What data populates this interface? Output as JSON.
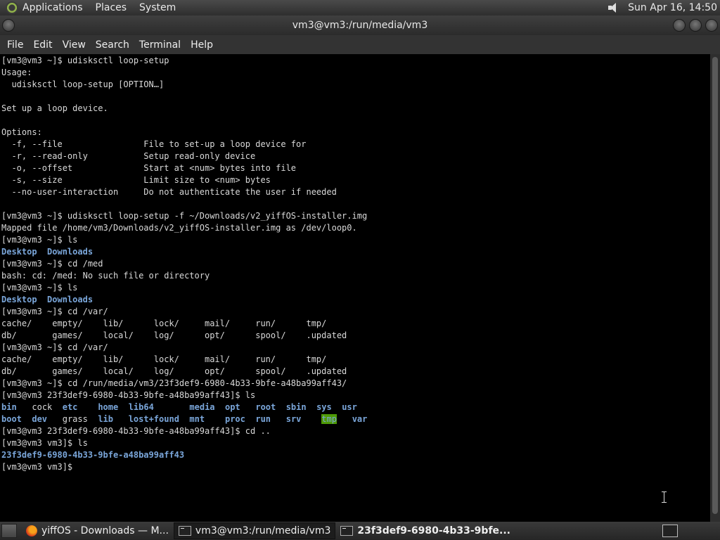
{
  "panel": {
    "menus": [
      "Applications",
      "Places",
      "System"
    ],
    "clock": "Sun Apr 16, 14:50"
  },
  "window": {
    "title": "vm3@vm3:/run/media/vm3"
  },
  "menubar": [
    "File",
    "Edit",
    "View",
    "Search",
    "Terminal",
    "Help"
  ],
  "terminal": {
    "lines": [
      "[vm3@vm3 ~]$ udisksctl loop-setup",
      "Usage:",
      "  udisksctl loop-setup [OPTION…]",
      "",
      "Set up a loop device.",
      "",
      "Options:",
      "  -f, --file                File to set-up a loop device for",
      "  -r, --read-only           Setup read-only device",
      "  -o, --offset              Start at <num> bytes into file",
      "  -s, --size                Limit size to <num> bytes",
      "  --no-user-interaction     Do not authenticate the user if needed",
      "",
      "[vm3@vm3 ~]$ udisksctl loop-setup -f ~/Downloads/v2_yiffOS-installer.img",
      "Mapped file /home/vm3/Downloads/v2_yiffOS-installer.img as /dev/loop0.",
      "[vm3@vm3 ~]$ ls",
      "__LS1__",
      "[vm3@vm3 ~]$ cd /med",
      "bash: cd: /med: No such file or directory",
      "[vm3@vm3 ~]$ ls",
      "__LS2__",
      "[vm3@vm3 ~]$ cd /var/",
      "cache/    empty/    lib/      lock/     mail/     run/      tmp/",
      "db/       games/    local/    log/      opt/      spool/    .updated",
      "[vm3@vm3 ~]$ cd /var/",
      "cache/    empty/    lib/      lock/     mail/     run/      tmp/",
      "db/       games/    local/    log/      opt/      spool/    .updated",
      "[vm3@vm3 ~]$ cd /run/media/vm3/23f3def9-6980-4b33-9bfe-a48ba99aff43/",
      "[vm3@vm3 23f3def9-6980-4b33-9bfe-a48ba99aff43]$ ls",
      "__LS3__",
      "__LS4__",
      "[vm3@vm3 23f3def9-6980-4b33-9bfe-a48ba99aff43]$ cd ..",
      "[vm3@vm3 vm3]$ ls",
      "__LS5__",
      "[vm3@vm3 vm3]$ "
    ],
    "ls_home": [
      [
        "Desktop",
        "dir"
      ],
      [
        "  ",
        ""
      ],
      [
        "Downloads",
        "dir"
      ]
    ],
    "ls_root_1": [
      [
        "bin",
        "dir"
      ],
      [
        "   ",
        ""
      ],
      [
        "cock",
        ""
      ],
      [
        "  ",
        ""
      ],
      [
        "etc",
        "dir"
      ],
      [
        "    ",
        ""
      ],
      [
        "home",
        "dir"
      ],
      [
        "  ",
        ""
      ],
      [
        "lib64",
        "dir"
      ],
      [
        "       ",
        ""
      ],
      [
        "media",
        "dir"
      ],
      [
        "  ",
        ""
      ],
      [
        "opt",
        "dir"
      ],
      [
        "   ",
        ""
      ],
      [
        "root",
        "dir"
      ],
      [
        "  ",
        ""
      ],
      [
        "sbin",
        "dir"
      ],
      [
        "  ",
        ""
      ],
      [
        "sys",
        "dir"
      ],
      [
        "  ",
        ""
      ],
      [
        "usr",
        "dir"
      ]
    ],
    "ls_root_2": [
      [
        "boot",
        "dir"
      ],
      [
        "  ",
        ""
      ],
      [
        "dev",
        "dir"
      ],
      [
        "   ",
        ""
      ],
      [
        "grass",
        ""
      ],
      [
        "  ",
        ""
      ],
      [
        "lib",
        "dir"
      ],
      [
        "   ",
        ""
      ],
      [
        "lost+found",
        "dir"
      ],
      [
        "  ",
        ""
      ],
      [
        "mnt",
        "dir"
      ],
      [
        "    ",
        ""
      ],
      [
        "proc",
        "dir"
      ],
      [
        "  ",
        ""
      ],
      [
        "run",
        "dir"
      ],
      [
        "   ",
        ""
      ],
      [
        "srv",
        "dir"
      ],
      [
        "    ",
        ""
      ],
      [
        "tmp",
        "tmp"
      ],
      [
        "   ",
        ""
      ],
      [
        "var",
        "dir"
      ]
    ],
    "ls_vm3": [
      [
        "23f3def9-6980-4b33-9bfe-a48ba99aff43",
        "dir"
      ]
    ]
  },
  "taskbar": {
    "tasks": [
      "yiffOS - Downloads — M...",
      "vm3@vm3:/run/media/vm3",
      "23f3def9-6980-4b33-9bfe..."
    ]
  }
}
